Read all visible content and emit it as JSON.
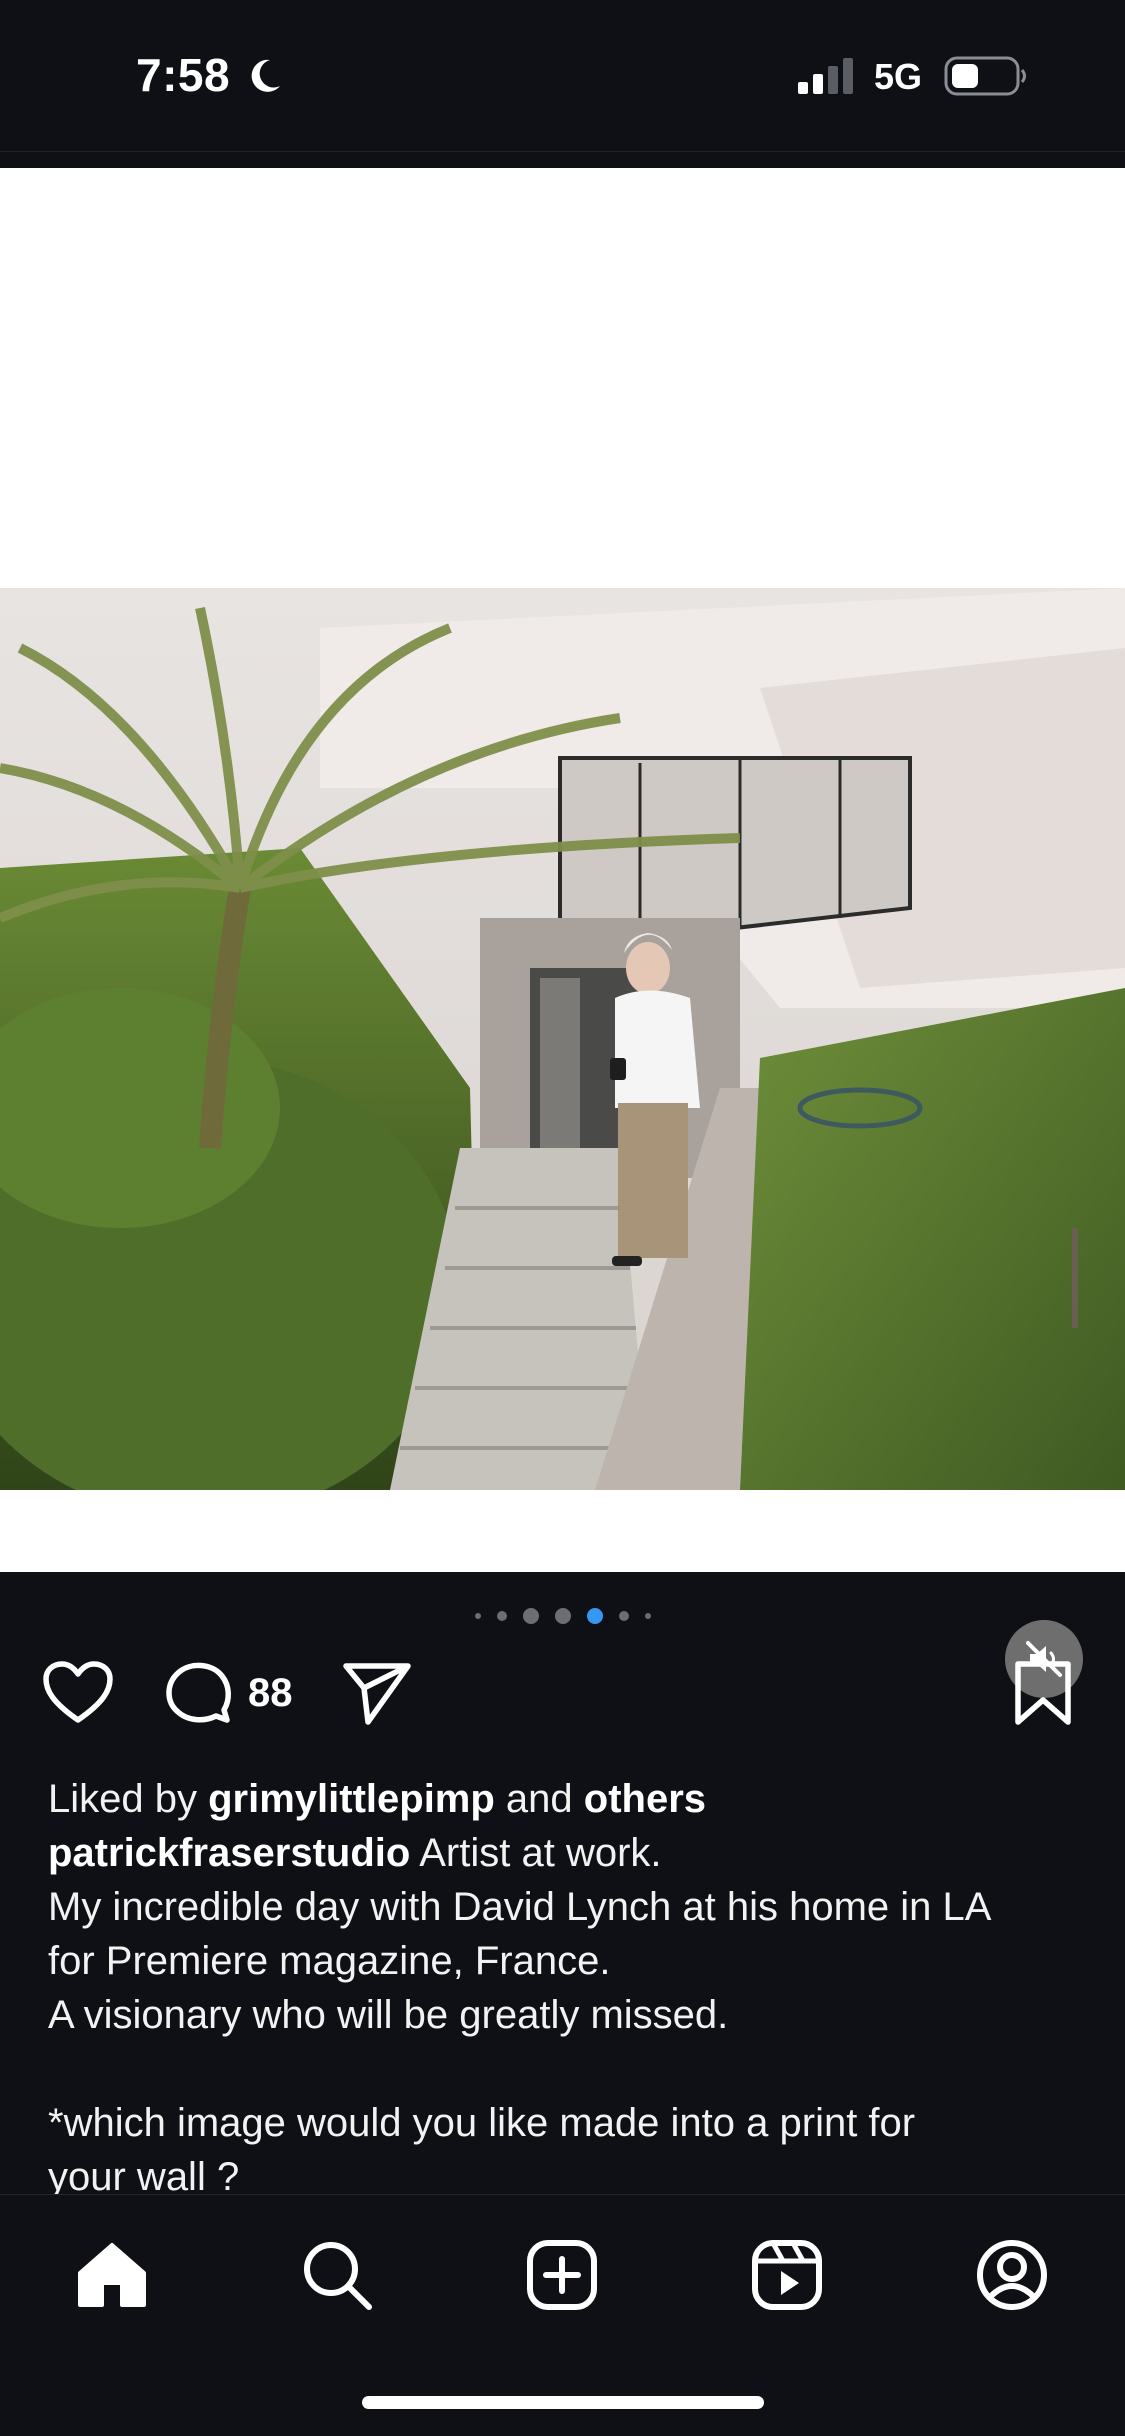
{
  "status_bar": {
    "time": "7:58",
    "network": "5G",
    "icons": [
      "moon-icon",
      "signal-icon",
      "battery-icon"
    ]
  },
  "post": {
    "image_description_icon": "photo",
    "carousel": {
      "total": 7,
      "active_index": 4
    },
    "comment_count": "88",
    "liked_by_prefix": "Liked by ",
    "liked_by_user": "grimylittlepimp",
    "liked_by_and": " and ",
    "liked_by_others": "others",
    "author": "patrickfraserstudio",
    "caption_first": " Artist at work.",
    "caption_lines": [
      "My incredible day with David Lynch at his home in LA",
      "for Premiere magazine, France.",
      "A visionary who will be greatly missed."
    ],
    "caption_question_lines": [
      "*which image would you like made into a print for",
      "your wall ?"
    ]
  },
  "nav": {
    "items": [
      "home-icon",
      "search-icon",
      "create-icon",
      "reels-icon",
      "profile-icon"
    ]
  },
  "colors": {
    "background": "#0e1016",
    "accent": "#3797f0",
    "text": "#f2f2f2"
  }
}
